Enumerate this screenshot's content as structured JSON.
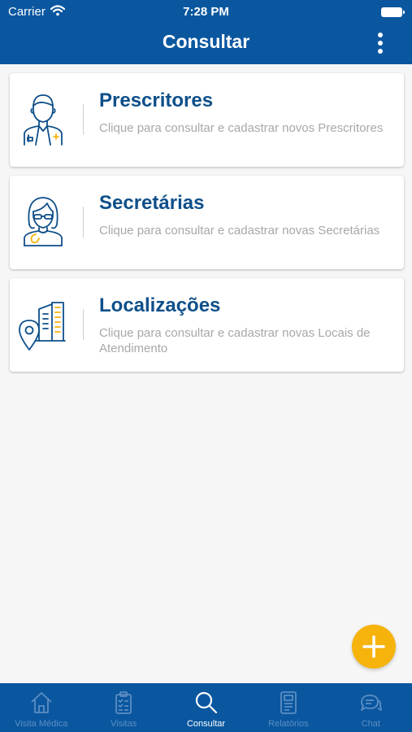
{
  "status_bar": {
    "carrier": "Carrier",
    "time": "7:28 PM"
  },
  "header": {
    "title": "Consultar"
  },
  "cards": [
    {
      "title": "Prescritores",
      "description": "Clique para consultar e cadastrar novos Prescritores",
      "icon": "doctor-icon"
    },
    {
      "title": "Secretárias",
      "description": "Clique para consultar e cadastrar novas Secretárias",
      "icon": "secretary-icon"
    },
    {
      "title": "Localizações",
      "description": "Clique para consultar e cadastrar novas Locais de Atendimento",
      "icon": "location-building-icon"
    }
  ],
  "fab": {
    "icon": "plus-icon"
  },
  "tabs": [
    {
      "label": "Visita Médica",
      "icon": "home-icon"
    },
    {
      "label": "Visitas",
      "icon": "clipboard-icon"
    },
    {
      "label": "Consultar",
      "icon": "search-icon",
      "active": true
    },
    {
      "label": "Relatórios",
      "icon": "report-icon"
    },
    {
      "label": "Chat",
      "icon": "chat-icon"
    }
  ],
  "colors": {
    "primary": "#0a57a0",
    "title_text": "#0e4f8a",
    "accent": "#f5b30c",
    "description_text": "#a8a8a8",
    "background": "#f6f6f6"
  }
}
